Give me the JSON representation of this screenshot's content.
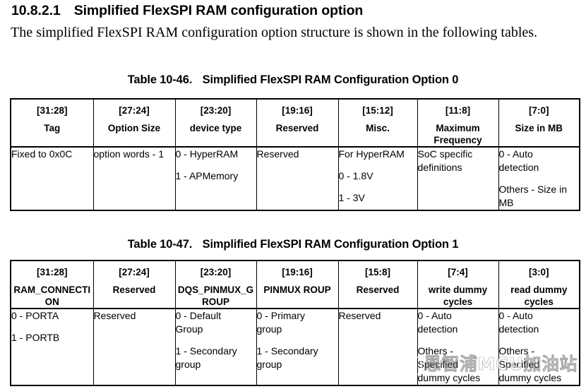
{
  "heading": {
    "number": "10.8.2.1",
    "title": "Simplified FlexSPI RAM configuration option"
  },
  "intro": "The simplified FlexSPI RAM configuration option structure is shown in the following tables.",
  "table1": {
    "caption_number": "Table 10-46.",
    "caption_title": "Simplified FlexSPI RAM Configuration Option 0",
    "columns": [
      {
        "bits": "[31:28]",
        "name": "Tag"
      },
      {
        "bits": "[27:24]",
        "name": "Option Size"
      },
      {
        "bits": "[23:20]",
        "name": "device type"
      },
      {
        "bits": "[19:16]",
        "name": "Reserved"
      },
      {
        "bits": "[15:12]",
        "name": "Misc."
      },
      {
        "bits": "[11:8]",
        "name": "Maximum Frequency"
      },
      {
        "bits": "[7:0]",
        "name": "Size in MB"
      }
    ],
    "cells": [
      {
        "lines": [
          "Fixed to 0x0C"
        ],
        "gaps": [
          false
        ]
      },
      {
        "lines": [
          "option words - 1"
        ],
        "gaps": [
          false
        ]
      },
      {
        "lines": [
          "0 - HyperRAM",
          "1 - APMemory"
        ],
        "gaps": [
          false,
          true
        ]
      },
      {
        "lines": [
          "Reserved"
        ],
        "gaps": [
          false
        ]
      },
      {
        "lines": [
          "For HyperRAM",
          "0 - 1.8V",
          "1 - 3V"
        ],
        "gaps": [
          false,
          true,
          true
        ]
      },
      {
        "lines": [
          "SoC specific",
          "definitions"
        ],
        "gaps": [
          false,
          false
        ]
      },
      {
        "lines": [
          "0 - Auto",
          "detection",
          "Others - Size in",
          "MB"
        ],
        "gaps": [
          false,
          false,
          true,
          false
        ]
      }
    ]
  },
  "table2": {
    "caption_number": "Table 10-47.",
    "caption_title": "Simplified FlexSPI RAM Configuration Option 1",
    "columns": [
      {
        "bits": "[31:28]",
        "name": "RAM_CONNECTION"
      },
      {
        "bits": "[27:24]",
        "name": "Reserved"
      },
      {
        "bits": "[23:20]",
        "name": "DQS_PINMUX_GROUP"
      },
      {
        "bits": "[19:16]",
        "name": "PINMUX ROUP"
      },
      {
        "bits": "[15:8]",
        "name": "Reserved"
      },
      {
        "bits": "[7:4]",
        "name": "write dummy cycles"
      },
      {
        "bits": "[3:0]",
        "name": "read dummy cycles"
      }
    ],
    "cells": [
      {
        "lines": [
          "0 - PORTA",
          "1 - PORTB"
        ],
        "gaps": [
          false,
          true
        ]
      },
      {
        "lines": [
          "Reserved"
        ],
        "gaps": [
          false
        ]
      },
      {
        "lines": [
          "0 - Default",
          "Group",
          "1 - Secondary",
          "group"
        ],
        "gaps": [
          false,
          false,
          true,
          false
        ]
      },
      {
        "lines": [
          "0 - Primary",
          "group",
          "1 - Secondary",
          "group"
        ],
        "gaps": [
          false,
          false,
          true,
          false
        ]
      },
      {
        "lines": [
          "Reserved"
        ],
        "gaps": [
          false
        ]
      },
      {
        "lines": [
          "0 - Auto",
          "detection",
          "Others -",
          "Specified",
          "dummy cycles"
        ],
        "gaps": [
          false,
          false,
          true,
          false,
          false
        ]
      },
      {
        "lines": [
          "0 - Auto",
          "detection",
          "Others -",
          "Specified",
          "dummy cycles"
        ],
        "gaps": [
          false,
          false,
          true,
          false,
          false
        ]
      }
    ]
  },
  "watermark": {
    "text": "恩智浦MCU加油站"
  }
}
